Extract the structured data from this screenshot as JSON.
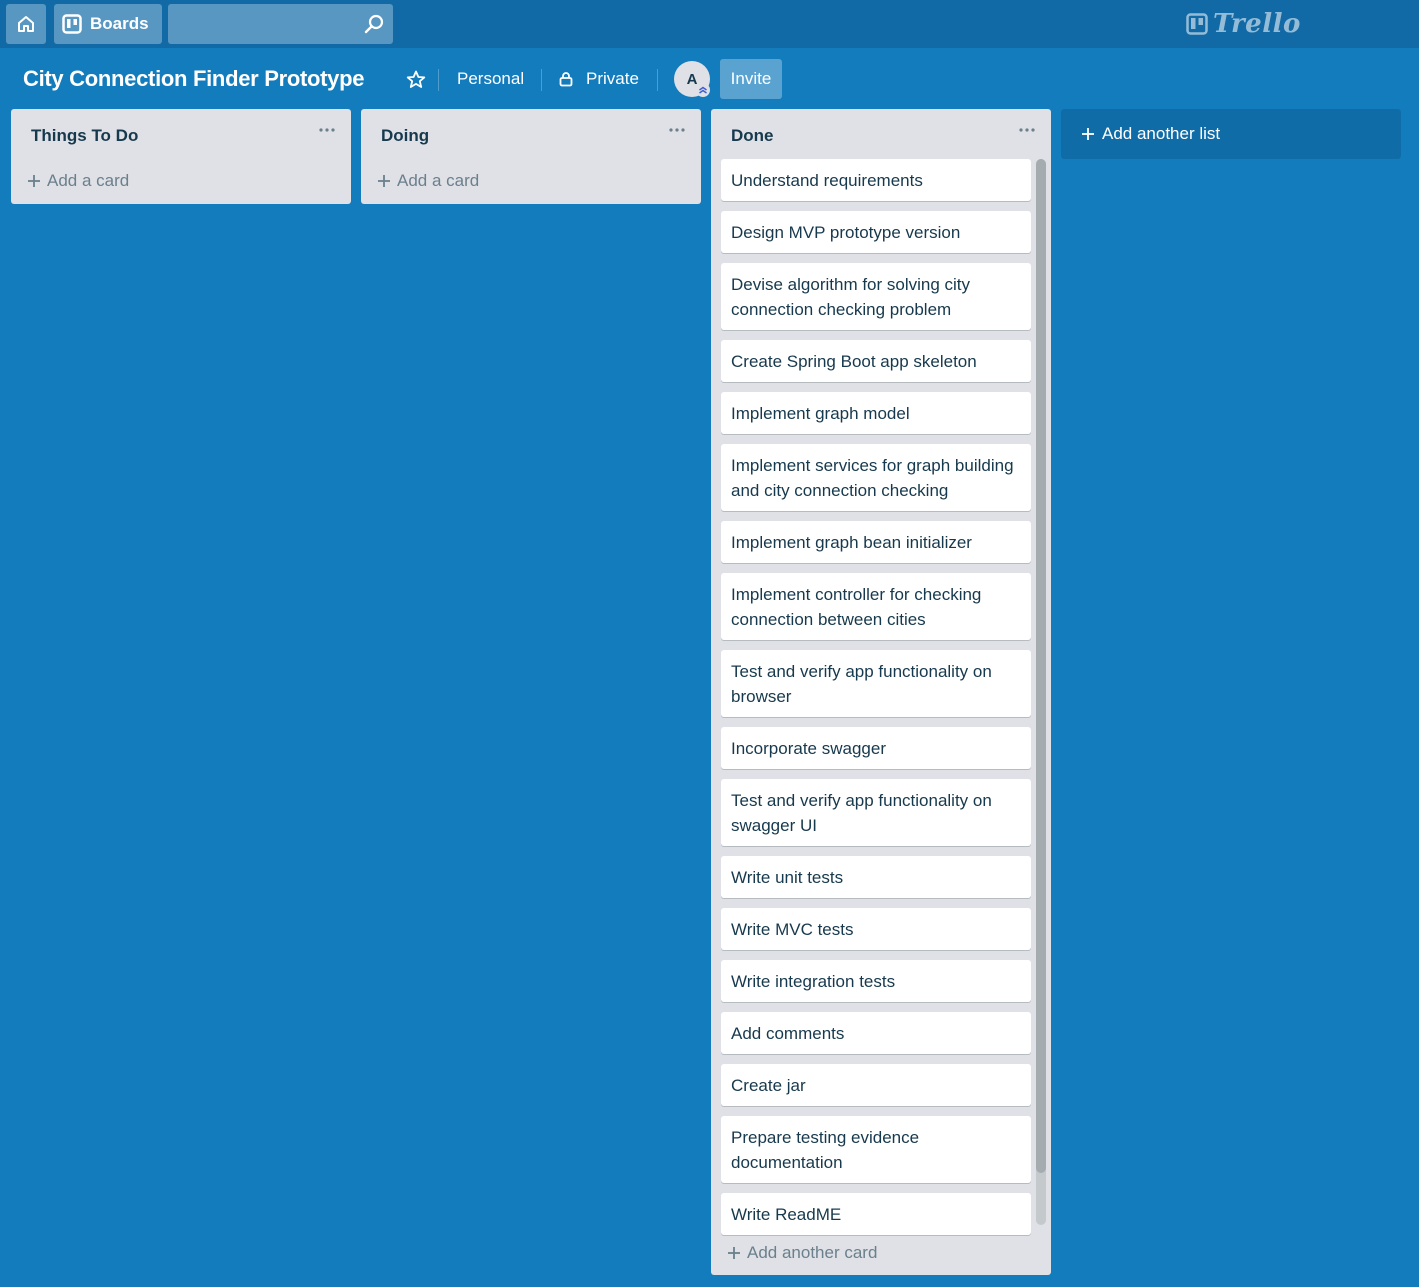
{
  "header": {
    "home_icon": "home-icon",
    "boards_label": "Boards",
    "search_value": "",
    "search_placeholder": "",
    "logo_text": "Trello"
  },
  "board": {
    "title": "City Connection Finder Prototype",
    "team_label": "Personal",
    "visibility_label": "Private",
    "member_initial": "A",
    "invite_label": "Invite"
  },
  "lists": [
    {
      "title": "Things To Do",
      "add_card_label": "Add a card",
      "cards": []
    },
    {
      "title": "Doing",
      "add_card_label": "Add a card",
      "cards": []
    },
    {
      "title": "Done",
      "add_card_label": "Add another card",
      "cards": [
        "Understand requirements",
        "Design MVP prototype version",
        "Devise algorithm for solving city connection checking problem",
        "Create Spring Boot app skeleton",
        "Implement graph model",
        "Implement services for graph building and city connection checking",
        "Implement graph bean initializer",
        "Implement controller for checking connection between cities",
        "Test and verify app functionality on browser",
        "Incorporate swagger",
        "Test and verify app functionality on swagger UI",
        "Write unit tests",
        "Write MVC tests",
        "Write integration tests",
        "Add comments",
        "Create jar",
        "Prepare testing evidence documentation",
        "Write ReadME"
      ]
    }
  ],
  "add_list_label": "Add another list",
  "colors": {
    "background": "#137cbd",
    "header": "#116aa6",
    "list_bg": "#dfe1e6",
    "text": "#17394d",
    "muted": "#6b808c"
  }
}
